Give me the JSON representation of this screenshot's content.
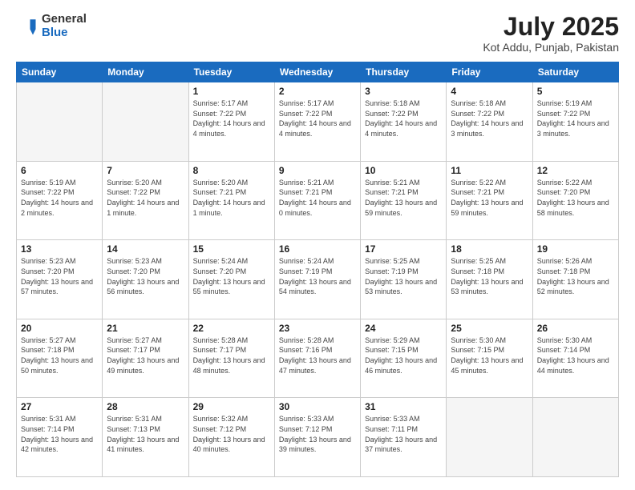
{
  "header": {
    "logo_general": "General",
    "logo_blue": "Blue",
    "month_title": "July 2025",
    "location": "Kot Addu, Punjab, Pakistan"
  },
  "weekdays": [
    "Sunday",
    "Monday",
    "Tuesday",
    "Wednesday",
    "Thursday",
    "Friday",
    "Saturday"
  ],
  "weeks": [
    [
      {
        "day": "",
        "empty": true
      },
      {
        "day": "",
        "empty": true
      },
      {
        "day": "1",
        "sunrise": "5:17 AM",
        "sunset": "7:22 PM",
        "daylight": "14 hours and 4 minutes."
      },
      {
        "day": "2",
        "sunrise": "5:17 AM",
        "sunset": "7:22 PM",
        "daylight": "14 hours and 4 minutes."
      },
      {
        "day": "3",
        "sunrise": "5:18 AM",
        "sunset": "7:22 PM",
        "daylight": "14 hours and 4 minutes."
      },
      {
        "day": "4",
        "sunrise": "5:18 AM",
        "sunset": "7:22 PM",
        "daylight": "14 hours and 3 minutes."
      },
      {
        "day": "5",
        "sunrise": "5:19 AM",
        "sunset": "7:22 PM",
        "daylight": "14 hours and 3 minutes."
      }
    ],
    [
      {
        "day": "6",
        "sunrise": "5:19 AM",
        "sunset": "7:22 PM",
        "daylight": "14 hours and 2 minutes."
      },
      {
        "day": "7",
        "sunrise": "5:20 AM",
        "sunset": "7:22 PM",
        "daylight": "14 hours and 1 minute."
      },
      {
        "day": "8",
        "sunrise": "5:20 AM",
        "sunset": "7:21 PM",
        "daylight": "14 hours and 1 minute."
      },
      {
        "day": "9",
        "sunrise": "5:21 AM",
        "sunset": "7:21 PM",
        "daylight": "14 hours and 0 minutes."
      },
      {
        "day": "10",
        "sunrise": "5:21 AM",
        "sunset": "7:21 PM",
        "daylight": "13 hours and 59 minutes."
      },
      {
        "day": "11",
        "sunrise": "5:22 AM",
        "sunset": "7:21 PM",
        "daylight": "13 hours and 59 minutes."
      },
      {
        "day": "12",
        "sunrise": "5:22 AM",
        "sunset": "7:20 PM",
        "daylight": "13 hours and 58 minutes."
      }
    ],
    [
      {
        "day": "13",
        "sunrise": "5:23 AM",
        "sunset": "7:20 PM",
        "daylight": "13 hours and 57 minutes."
      },
      {
        "day": "14",
        "sunrise": "5:23 AM",
        "sunset": "7:20 PM",
        "daylight": "13 hours and 56 minutes."
      },
      {
        "day": "15",
        "sunrise": "5:24 AM",
        "sunset": "7:20 PM",
        "daylight": "13 hours and 55 minutes."
      },
      {
        "day": "16",
        "sunrise": "5:24 AM",
        "sunset": "7:19 PM",
        "daylight": "13 hours and 54 minutes."
      },
      {
        "day": "17",
        "sunrise": "5:25 AM",
        "sunset": "7:19 PM",
        "daylight": "13 hours and 53 minutes."
      },
      {
        "day": "18",
        "sunrise": "5:25 AM",
        "sunset": "7:18 PM",
        "daylight": "13 hours and 53 minutes."
      },
      {
        "day": "19",
        "sunrise": "5:26 AM",
        "sunset": "7:18 PM",
        "daylight": "13 hours and 52 minutes."
      }
    ],
    [
      {
        "day": "20",
        "sunrise": "5:27 AM",
        "sunset": "7:18 PM",
        "daylight": "13 hours and 50 minutes."
      },
      {
        "day": "21",
        "sunrise": "5:27 AM",
        "sunset": "7:17 PM",
        "daylight": "13 hours and 49 minutes."
      },
      {
        "day": "22",
        "sunrise": "5:28 AM",
        "sunset": "7:17 PM",
        "daylight": "13 hours and 48 minutes."
      },
      {
        "day": "23",
        "sunrise": "5:28 AM",
        "sunset": "7:16 PM",
        "daylight": "13 hours and 47 minutes."
      },
      {
        "day": "24",
        "sunrise": "5:29 AM",
        "sunset": "7:15 PM",
        "daylight": "13 hours and 46 minutes."
      },
      {
        "day": "25",
        "sunrise": "5:30 AM",
        "sunset": "7:15 PM",
        "daylight": "13 hours and 45 minutes."
      },
      {
        "day": "26",
        "sunrise": "5:30 AM",
        "sunset": "7:14 PM",
        "daylight": "13 hours and 44 minutes."
      }
    ],
    [
      {
        "day": "27",
        "sunrise": "5:31 AM",
        "sunset": "7:14 PM",
        "daylight": "13 hours and 42 minutes."
      },
      {
        "day": "28",
        "sunrise": "5:31 AM",
        "sunset": "7:13 PM",
        "daylight": "13 hours and 41 minutes."
      },
      {
        "day": "29",
        "sunrise": "5:32 AM",
        "sunset": "7:12 PM",
        "daylight": "13 hours and 40 minutes."
      },
      {
        "day": "30",
        "sunrise": "5:33 AM",
        "sunset": "7:12 PM",
        "daylight": "13 hours and 39 minutes."
      },
      {
        "day": "31",
        "sunrise": "5:33 AM",
        "sunset": "7:11 PM",
        "daylight": "13 hours and 37 minutes."
      },
      {
        "day": "",
        "empty": true
      },
      {
        "day": "",
        "empty": true
      }
    ]
  ]
}
